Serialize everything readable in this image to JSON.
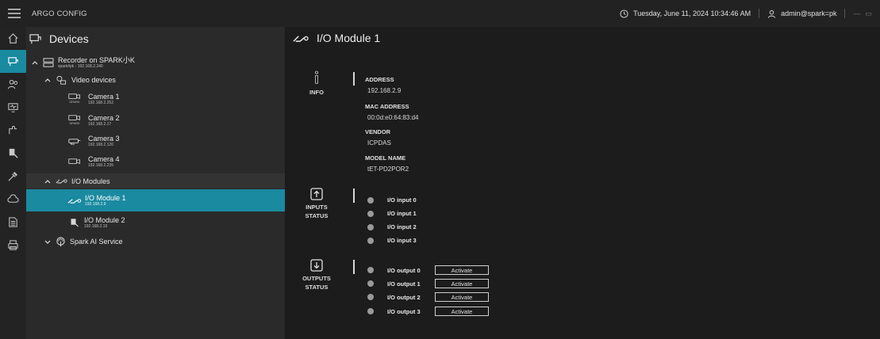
{
  "app": {
    "title": "ARGO CONFIG"
  },
  "status": {
    "datetime": "Tuesday, June 11, 2024 10:34:46 AM",
    "user": "admin@spark=pk"
  },
  "sidebar": {
    "items": [
      {
        "icon": "home-icon"
      },
      {
        "icon": "devices-icon"
      },
      {
        "icon": "users-icon"
      },
      {
        "icon": "monitor-icon"
      },
      {
        "icon": "puzzle-icon"
      },
      {
        "icon": "io-device-icon"
      },
      {
        "icon": "tools-icon"
      },
      {
        "icon": "cloud-icon"
      },
      {
        "icon": "document-icon"
      },
      {
        "icon": "printer-icon"
      }
    ]
  },
  "devices": {
    "title": "Devices",
    "recorder": {
      "label": "Recorder on SPARK小K",
      "sub": "spark#pk - 192.168.2.240"
    },
    "video_group": {
      "label": "Video devices"
    },
    "cameras": [
      {
        "label": "Camera 1",
        "brand": "SPARK",
        "ip": "192.168.2.252"
      },
      {
        "label": "Camera 2",
        "brand": "SPARK",
        "ip": "192.168.2.17"
      },
      {
        "label": "Camera 3",
        "brand": "",
        "ip": "192.168.2.120"
      },
      {
        "label": "Camera 4",
        "brand": "",
        "ip": "192.168.2.235"
      }
    ],
    "io_group": {
      "label": "I/O Modules"
    },
    "io_modules": [
      {
        "label": "I/O Module 1",
        "ip": "192.168.2.9"
      },
      {
        "label": "I/O Module 2",
        "ip": "192.168.2.19"
      }
    ],
    "ai_service": {
      "label": "Spark AI Service"
    }
  },
  "detail": {
    "title": "I/O Module 1",
    "info": {
      "caption": "INFO",
      "address_label": "ADDRESS",
      "address": "192.168.2.9",
      "mac_label": "MAC ADDRESS",
      "mac": "00:0d:e0:64:83:d4",
      "vendor_label": "VENDOR",
      "vendor": "ICPDAS",
      "model_label": "MODEL NAME",
      "model": "tET-PD2POR2"
    },
    "inputs": {
      "caption_1": "INPUTS",
      "caption_2": "STATUS",
      "items": [
        "I/O input 0",
        "I/O input 1",
        "I/O input 2",
        "I/O input 3"
      ]
    },
    "outputs": {
      "caption_1": "OUTPUTS",
      "caption_2": "STATUS",
      "button_label": "Activate",
      "items": [
        "I/O output 0",
        "I/O output 1",
        "I/O output 2",
        "I/O output 3"
      ]
    }
  }
}
